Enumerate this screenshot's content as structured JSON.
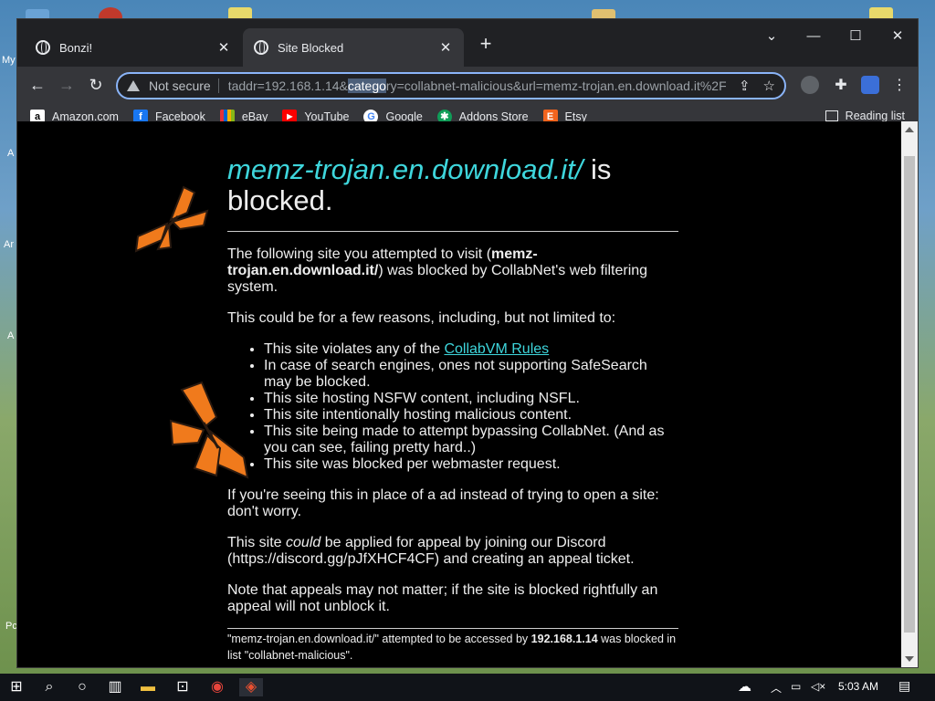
{
  "desktop": {
    "labels": [
      "My",
      "A",
      "Ar",
      "A",
      "Pc"
    ]
  },
  "browser": {
    "tabs": [
      {
        "title": "Bonzi!",
        "close": "✕"
      },
      {
        "title": "Site Blocked",
        "close": "✕"
      }
    ],
    "new_tab": "+",
    "window_controls": {
      "chevron": "⌄",
      "minimize": "—",
      "maximize": "☐",
      "close": "✕"
    },
    "toolbar": {
      "back": "←",
      "forward": "→",
      "reload": "↻",
      "security_label": "Not secure",
      "url_before": "taddr=192.168.1.14&",
      "url_highlight": "catego",
      "url_after": "ry=collabnet-malicious&url=memz-trojan.en.download.it%2F"
    },
    "bookmarks": [
      {
        "label": "Amazon.com",
        "icon": "amazon-icon",
        "color": "#ffffff"
      },
      {
        "label": "Facebook",
        "icon": "facebook-icon",
        "color": "#1877f2"
      },
      {
        "label": "eBay",
        "icon": "ebay-icon",
        "color": "#e53238"
      },
      {
        "label": "YouTube",
        "icon": "youtube-icon",
        "color": "#ff0000"
      },
      {
        "label": "Google",
        "icon": "google-icon",
        "color": "#4285f4"
      },
      {
        "label": "Addons Store",
        "icon": "addons-store-icon",
        "color": "#0f9d58"
      },
      {
        "label": "Etsy",
        "icon": "etsy-icon",
        "color": "#f1641e"
      }
    ],
    "reading_list": "Reading list"
  },
  "page": {
    "site": "memz-trojan.en.download.it/",
    "headline_suffix": " is blocked.",
    "intro_before": "The following site you attempted to visit (",
    "intro_site": "memz-trojan.en.download.it/",
    "intro_after": ") was blocked by CollabNet's web filtering system.",
    "reasons_intro": "This could be for a few reasons, including, but not limited to:",
    "reason_1_before": "This site violates any of the ",
    "reason_1_link": "CollabVM Rules",
    "reasons": [
      "In case of search engines, ones not supporting SafeSearch may be blocked.",
      "This site hosting NSFW content, including NSFL.",
      "This site intentionally hosting malicious content.",
      "This site being made to attempt bypassing CollabNet. (And as you can see, failing pretty hard..)",
      "This site was blocked per webmaster request."
    ],
    "ad_note": "If you're seeing this in place of a ad instead of trying to open a site: don't worry.",
    "appeal_before": "This site ",
    "appeal_em": "could",
    "appeal_after": " be applied for appeal by joining our Discord (https://discord.gg/pJfXHCF4CF) and creating an appeal ticket.",
    "appeal_note": "Note that appeals may not matter; if the site is blocked rightfully an appeal will not unblock it.",
    "footer_before": "\"memz-trojan.en.download.it/\" attempted to be accessed by ",
    "footer_ip": "192.168.1.14",
    "footer_after": " was blocked in list \"collabnet-malicious\"."
  },
  "taskbar": {
    "clock": "5:03 AM"
  },
  "colors": {
    "link": "#3ed6dc",
    "butterfly": "#f07a1c"
  }
}
